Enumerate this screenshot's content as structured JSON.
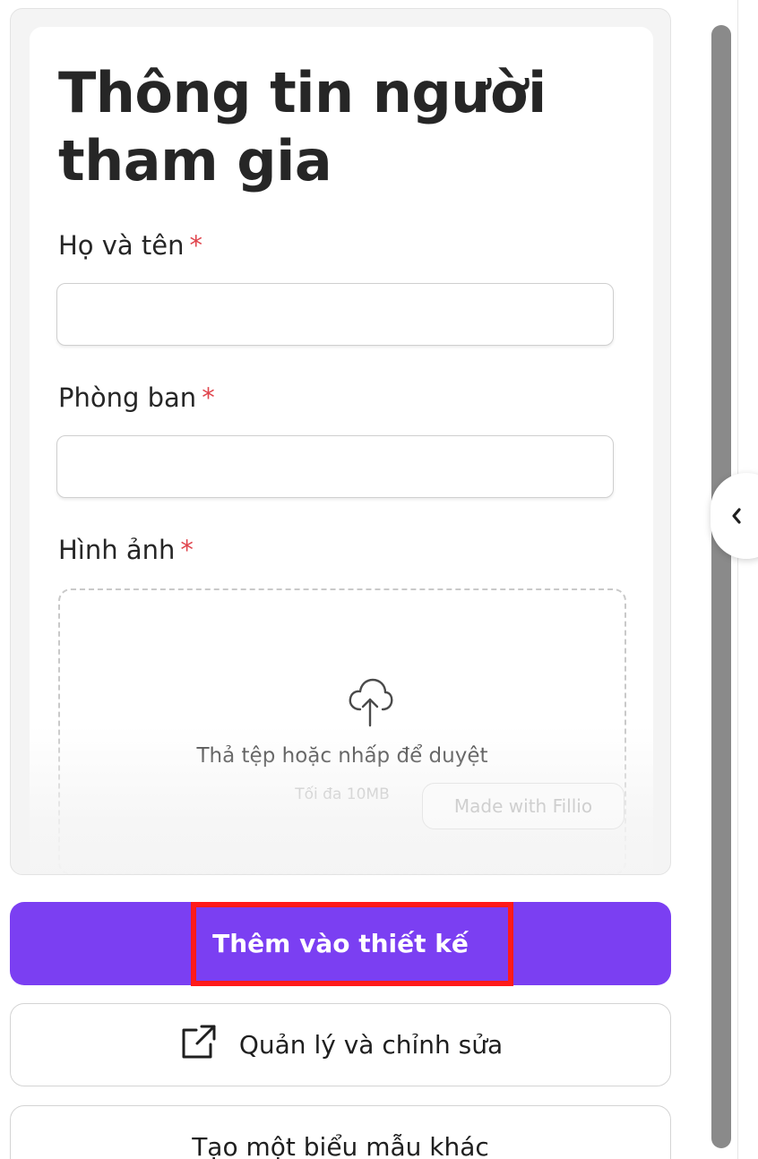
{
  "form": {
    "title": "Thông tin người tham gia",
    "fields": [
      {
        "label": "Họ và tên",
        "required_mark": "*",
        "value": ""
      },
      {
        "label": "Phòng ban",
        "required_mark": "*",
        "value": ""
      },
      {
        "label": "Hình ảnh",
        "required_mark": "*"
      }
    ],
    "upload": {
      "icon": "cloud-upload-icon",
      "text": "Thả tệp hoặc nhấp để duyệt",
      "subtext": "Tối đa 10MB"
    },
    "badge": "Made with Fillio"
  },
  "actions": {
    "primary_label": "Thêm vào thiết kế",
    "manage_label": "Quản lý và chỉnh sửa",
    "manage_icon": "external-link-icon",
    "create_label": "Tạo một biểu mẫu khác"
  },
  "sidebar": {
    "collapse_icon": "chevron-left-icon"
  },
  "colors": {
    "primary": "#7b3ff2",
    "required": "#e0454d",
    "highlight": "#ff1a1a"
  }
}
